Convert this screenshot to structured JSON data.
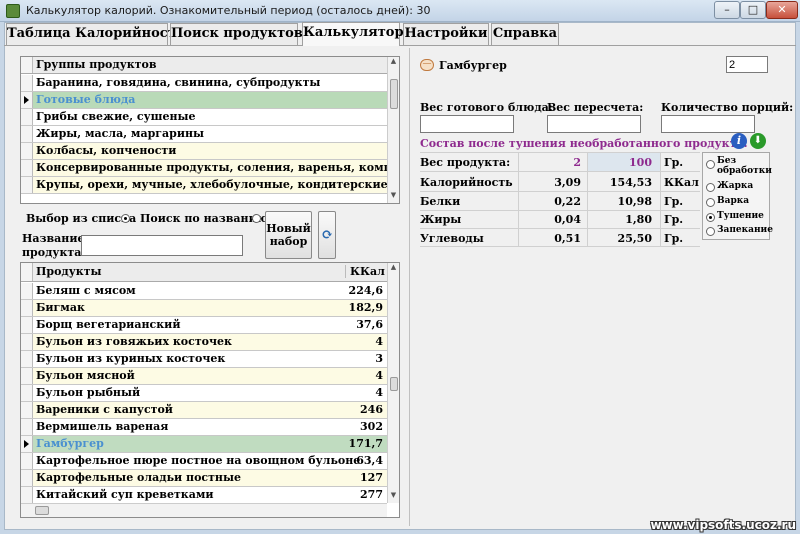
{
  "window": {
    "title": "Калькулятор калорий. Ознакомительный период (осталось дней): 30",
    "minimize_glyph": "–",
    "maximize_glyph": "□",
    "close_glyph": "✕"
  },
  "tabs": [
    {
      "label": "Таблица Калорийности"
    },
    {
      "label": "Поиск продуктов"
    },
    {
      "label": "Калькулятор"
    },
    {
      "label": "Настройки"
    },
    {
      "label": "Справка"
    }
  ],
  "groups_grid": {
    "header": "Группы продуктов",
    "rows": [
      "Баранина, говядина, свинина, субпродукты",
      "Готовые блюда",
      "Грибы свежие, сушеные",
      "Жиры, масла, маргарины",
      "Колбасы, копчености",
      "Консервированные продукты, соления, варенья, компоты",
      "Крупы, орехи, мучные, хлебобулочные, кондитерские изделия"
    ],
    "selected_index": 1
  },
  "search": {
    "from_list_label": "Выбор из списка",
    "by_name_label": "Поиск по названию",
    "mode": "from_list",
    "name_label_line1": "Название",
    "name_label_line2": "продукта:",
    "name_value": "",
    "new_set_line1": "Новый",
    "new_set_line2": "набор",
    "refresh_glyph": "⟳"
  },
  "products_grid": {
    "header_name": "Продукты",
    "header_kcal": "ККал",
    "rows": [
      {
        "name": "Беляш с мясом",
        "kcal": "224,6"
      },
      {
        "name": "Бигмак",
        "kcal": "182,9"
      },
      {
        "name": "Борщ вегетарианский",
        "kcal": "37,6"
      },
      {
        "name": "Бульон из говяжьих косточек",
        "kcal": "4"
      },
      {
        "name": "Бульон из куриных косточек",
        "kcal": "3"
      },
      {
        "name": "Бульон мясной",
        "kcal": "4"
      },
      {
        "name": "Бульон рыбный",
        "kcal": "4"
      },
      {
        "name": "Вареники с капустой",
        "kcal": "246"
      },
      {
        "name": "Вермишель вареная",
        "kcal": "302"
      },
      {
        "name": "Гамбургер",
        "kcal": "171,7"
      },
      {
        "name": "Картофельное пюре постное на овощном бульоне",
        "kcal": "63,4"
      },
      {
        "name": "Картофельные оладьи постные",
        "kcal": "127"
      },
      {
        "name": "Китайский суп креветками",
        "kcal": "277"
      }
    ],
    "selected_index": 9
  },
  "calculator": {
    "product_name": "Гамбургер",
    "product_icon": "—",
    "amount_value": "2",
    "ready_weight_label": "Вес готового блюда:",
    "recalc_weight_label": "Вес пересчета:",
    "portions_label": "Количество порций:",
    "ready_weight_value": "",
    "recalc_weight_value": "",
    "portions_value": "",
    "composition_title": "Состав после тушения необработанного продукта:",
    "info_glyph": "i",
    "download_glyph": "⬇",
    "rows": [
      {
        "label": "Вес продукта:",
        "v1": "2",
        "v2": "100",
        "unit": "Гр."
      },
      {
        "label": "Калорийность",
        "v1": "3,09",
        "v2": "154,53",
        "unit": "ККал"
      },
      {
        "label": "Белки",
        "v1": "0,22",
        "v2": "10,98",
        "unit": "Гр."
      },
      {
        "label": "Жиры",
        "v1": "0,04",
        "v2": "1,80",
        "unit": "Гр."
      },
      {
        "label": "Углеводы",
        "v1": "0,51",
        "v2": "25,50",
        "unit": "Гр."
      }
    ],
    "processing_options": [
      "Без обработки",
      "Жарка",
      "Варка",
      "Тушение",
      "Запекание"
    ],
    "processing_selected": 3
  },
  "watermark": "www.vipsofts.ucoz.ru",
  "colors": {
    "accent_purple": "#8e2a8e",
    "selected_row_bg": "#b9dab8",
    "selected_row_text": "#4a90d0",
    "alt_row_bg": "#fdfbe4"
  }
}
